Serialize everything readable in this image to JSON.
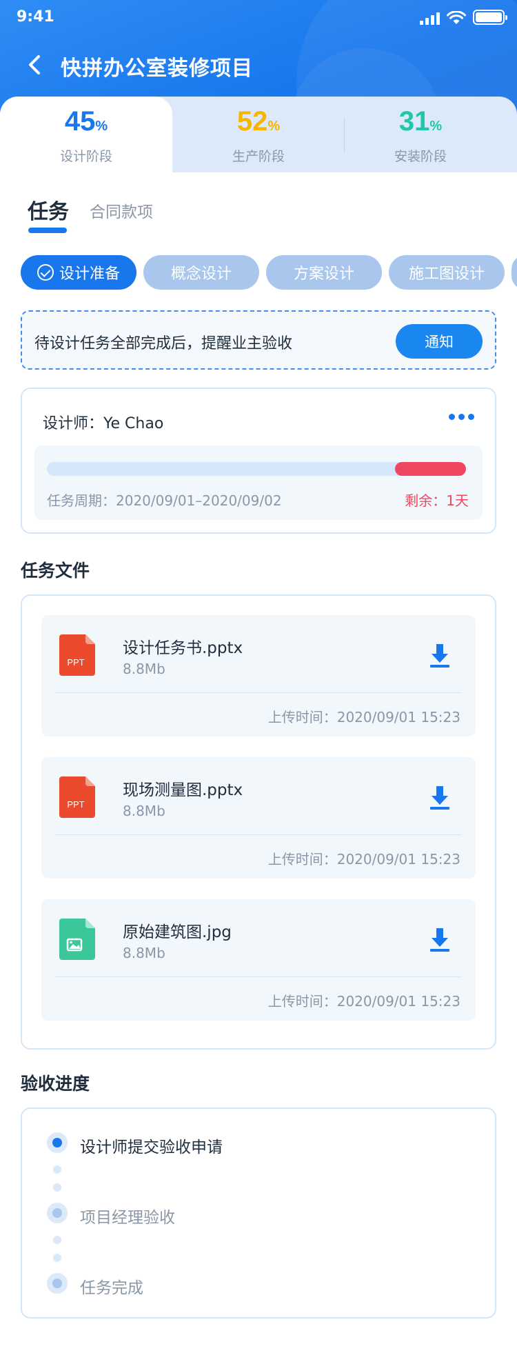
{
  "status_bar": {
    "time": "9:41"
  },
  "nav": {
    "title": "快拼办公室装修项目"
  },
  "stages": [
    {
      "value": "45",
      "unit": "%",
      "label": "设计阶段",
      "color": "#1877ec"
    },
    {
      "value": "52",
      "unit": "%",
      "label": "生产阶段",
      "color": "#f7b500"
    },
    {
      "value": "31",
      "unit": "%",
      "label": "安装阶段",
      "color": "#21c7a8"
    }
  ],
  "tabs": {
    "task": "任务",
    "contract": "合同款项"
  },
  "chips": [
    {
      "label": "设计准备"
    },
    {
      "label": "概念设计"
    },
    {
      "label": "方案设计"
    },
    {
      "label": "施工图设计"
    }
  ],
  "notice": {
    "text": "待设计任务全部完成后，提醒业主验收",
    "button": "通知"
  },
  "designer": {
    "label": "设计师：Ye Chao",
    "period": "任务周期：2020/09/01–2020/09/02",
    "remaining": "剩余：1天",
    "remaining_fraction": 0.17
  },
  "files": {
    "title": "任务文件",
    "items": [
      {
        "name": "设计任务书.pptx",
        "size": "8.8Mb",
        "type_label": "PPT",
        "time": "上传时间：2020/09/01 15:23"
      },
      {
        "name": "现场测量图.pptx",
        "size": "8.8Mb",
        "type_label": "PPT",
        "time": "上传时间：2020/09/01 15:23"
      },
      {
        "name": "原始建筑图.jpg",
        "size": "8.8Mb",
        "type_label": "",
        "time": "上传时间：2020/09/01 15:23"
      }
    ]
  },
  "acceptance": {
    "title": "验收进度",
    "steps": [
      {
        "label": "设计师提交验收申请"
      },
      {
        "label": "项目经理验收"
      },
      {
        "label": "任务完成"
      }
    ]
  },
  "icons": {
    "back": "chevron-left-icon",
    "more": "more-dots-icon",
    "download": "download-icon",
    "ppt_file": "ppt-file-icon",
    "image_file": "image-file-icon",
    "check": "check-circle-icon"
  }
}
